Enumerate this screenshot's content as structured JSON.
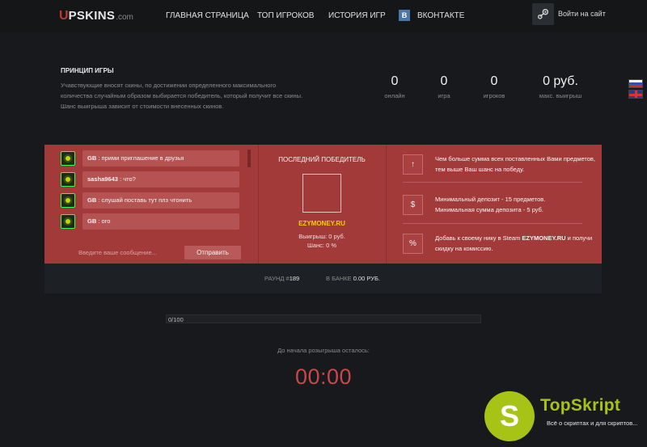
{
  "header": {
    "logo": {
      "mark": "U",
      "name": "PSKINS",
      "domain": ".com"
    },
    "nav": [
      {
        "label": "ГЛАВНАЯ СТРАНИЦА"
      },
      {
        "label": "ТОП ИГРОКОВ"
      },
      {
        "label": "ИСТОРИЯ ИГР"
      },
      {
        "label": "ВКОНТАКТЕ",
        "badge": "В"
      }
    ],
    "login_label": "Войти на сайт",
    "login_icon": "steam-icon"
  },
  "info": {
    "title": "ПРИНЦИП ИГРЫ",
    "text": "Учавствующие вносят скины, по достижении определенного максимального количества случайным образом выбирается победитель, который получит все скины. Шанс выигрыша зависит от стоимости внесенных скинов."
  },
  "stats": [
    {
      "value": "0",
      "label": "онлайн"
    },
    {
      "value": "0",
      "label": "игра"
    },
    {
      "value": "0",
      "label": "игроков"
    },
    {
      "value": "0 руб.",
      "label": "макс. выигрыш"
    }
  ],
  "languages": [
    "ru-flag-icon",
    "en-flag-icon"
  ],
  "chat": {
    "messages": [
      {
        "user": "GB",
        "text": "прими приглашение в друзья"
      },
      {
        "user": "sasha9643",
        "text": "что?"
      },
      {
        "user": "GB",
        "text": "слушай поставь тут плз чтонить"
      },
      {
        "user": "GB",
        "text": "ого"
      }
    ],
    "input_placeholder": "Введите ваше сообщение...",
    "send_label": "Отправить"
  },
  "winner": {
    "title": "ПОСЛЕДНИЙ ПОБЕДИТЕЛЬ",
    "name": "EZYMONEY.RU",
    "win_line": "Выигрыш: 0 руб.",
    "chance_line": "Шанс: 0 %"
  },
  "perks": [
    {
      "icon": "↑",
      "icon_name": "arrow-up-icon",
      "text": "Чем больше сумма всех поставленных Вами предметов, тем выше Ваш шанс на победу."
    },
    {
      "icon": "$",
      "icon_name": "dollar-icon",
      "line1": "Минимальный депозит - 15 предметов.",
      "line2": "Минимальная сумма депозита - 5 руб."
    },
    {
      "icon": "%",
      "icon_name": "percent-icon",
      "pre": "Добавь к своему нику в Steam ",
      "brand": "EZYMONEY.RU",
      "post": " и получи скидку на комиссию."
    }
  ],
  "round": {
    "round_label": "РАУНД #",
    "round_value": "189",
    "bank_label": "В БАНКЕ ",
    "bank_value": "0.00 РУБ."
  },
  "progress": {
    "label": "0/100",
    "fraction": 0
  },
  "countdown": {
    "title": "До начала розыгрыша осталось:",
    "time": "00:00"
  },
  "watermark": {
    "letter": "S",
    "title": "TopSkript",
    "subtitle": "Всё о скриптах и для скриптов..."
  },
  "colors": {
    "accent": "#a33a3a",
    "winner_name": "#f3d200",
    "timer": "#c8474a",
    "watermark": "#a6c316"
  }
}
